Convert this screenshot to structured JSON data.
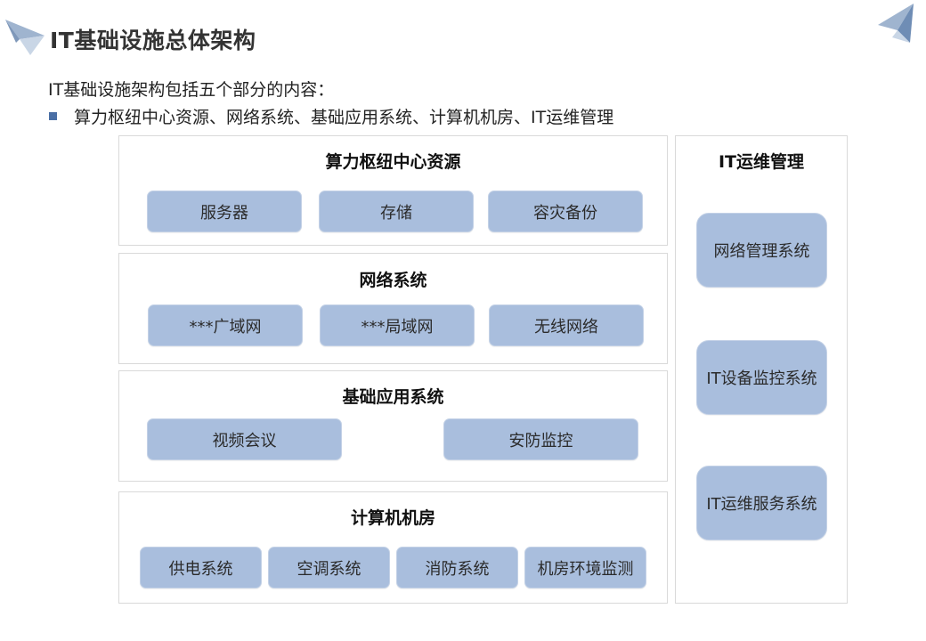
{
  "title": "IT基础设施总体架构",
  "intro": "IT基础设施架构包括五个部分的内容：",
  "bullet": "算力枢纽中心资源、网络系统、基础应用系统、计算机机房、IT运维管理",
  "colors": {
    "box_fill": "#a9bedd",
    "bullet": "#4a6fa5",
    "border": "#d9d9d9"
  },
  "decorations": {
    "left": "paper-plane-icon",
    "right": "paper-plane-icon"
  },
  "sections": {
    "compute": {
      "title": "算力枢纽中心资源",
      "items": [
        "服务器",
        "存储",
        "容灾备份"
      ]
    },
    "network": {
      "title": "网络系统",
      "items": [
        "***广域网",
        "***局域网",
        "无线网络"
      ]
    },
    "apps": {
      "title": "基础应用系统",
      "items": [
        "视频会议",
        "安防监控"
      ]
    },
    "room": {
      "title": "计算机机房",
      "items": [
        "供电系统",
        "空调系统",
        "消防系统",
        "机房环境监测"
      ]
    },
    "ops": {
      "title": "IT运维管理",
      "items": [
        "网络管理系统",
        "IT设备监控系统",
        "IT运维服务系统"
      ]
    }
  }
}
